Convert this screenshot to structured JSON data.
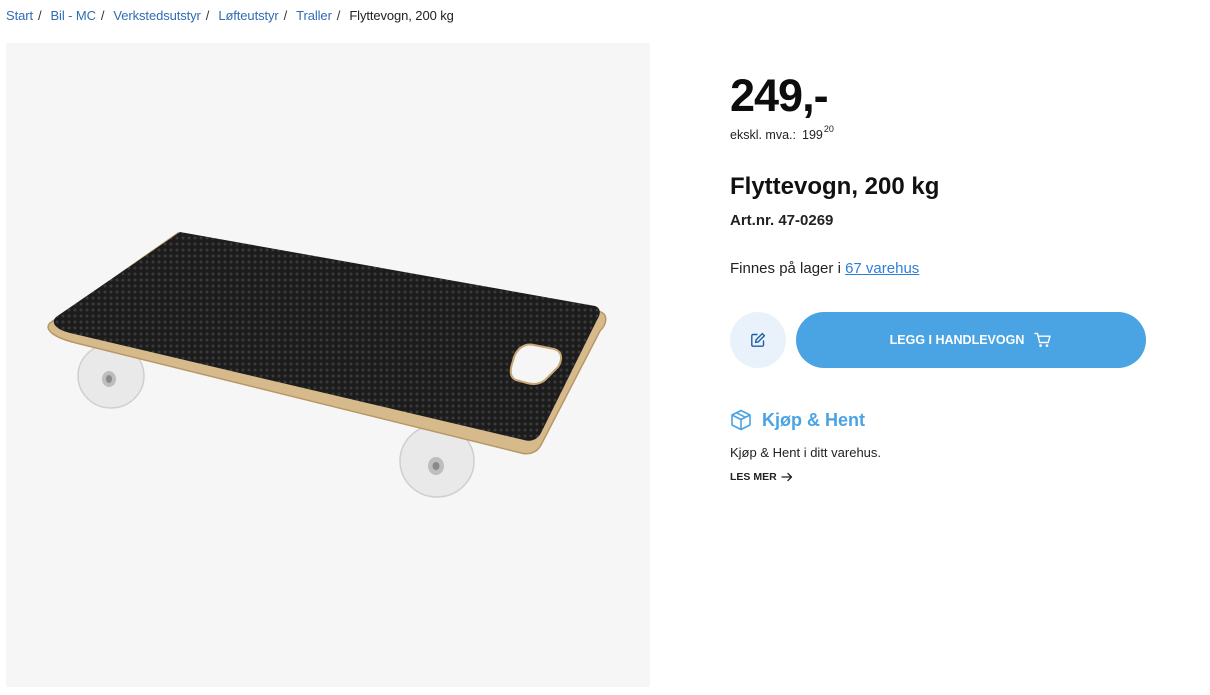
{
  "breadcrumb": {
    "links": [
      "Start",
      "Bil - MC",
      "Verkstedsutstyr",
      "Løfteutstyr",
      "Traller"
    ],
    "separator": "/",
    "current": "Flyttevogn, 200 kg"
  },
  "product": {
    "price": "249,-",
    "vat_label": "ekskl. mva.:",
    "vat_whole": "199",
    "vat_cents": "20",
    "title": "Flyttevogn, 200 kg",
    "art_nr": "Art.nr. 47-0269",
    "stock_prefix": "Finnes på lager i",
    "stock_link": "67 varehus",
    "image_alt": "Flyttevogn med svart gummiert topp, trekant og to hvite hjul"
  },
  "actions": {
    "note_icon": "pencil-note-icon",
    "cart_label": "LEGG I HANDLEVOGN",
    "cart_icon": "shopping-cart-icon"
  },
  "click_collect": {
    "icon": "package-box-icon",
    "title": "Kjøp & Hent",
    "text": "Kjøp & Hent i ditt varehus.",
    "more_label": "LES MER",
    "more_icon": "arrow-right-icon"
  },
  "colors": {
    "accent": "#4aa3e3",
    "link": "#2f6cb3",
    "note_button_bg": "#e9f1fa",
    "image_bg": "#f6f6f6"
  }
}
